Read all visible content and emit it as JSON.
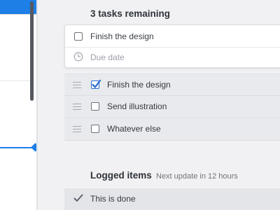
{
  "tasks": {
    "heading": "3 tasks remaining",
    "new_task": {
      "title": "Finish the design",
      "due_date_placeholder": "Due date"
    },
    "items": [
      {
        "label": "Finish the design",
        "checked": true
      },
      {
        "label": "Send illustration",
        "checked": false
      },
      {
        "label": "Whatever else",
        "checked": false
      }
    ]
  },
  "logged": {
    "heading": "Logged items",
    "subtitle": "Next update in 12 hours",
    "items": [
      {
        "label": "This is done"
      }
    ]
  },
  "colors": {
    "accent": "#1e7fe6",
    "background": "#f1f1f3",
    "checked_box": "#2d6fd2"
  },
  "icons": [
    "checkbox-icon",
    "clock-icon",
    "drag-handle-icon",
    "checkmark-icon"
  ]
}
